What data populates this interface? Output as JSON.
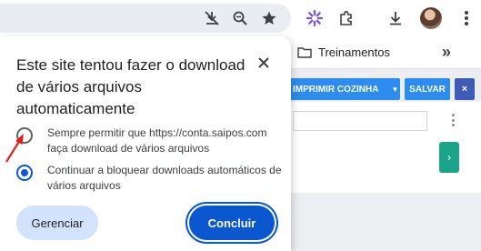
{
  "toolbar": {
    "icons": [
      "download-blocked-icon",
      "zoom-icon",
      "bookmark-star-icon",
      "extension-purple-icon",
      "extensions-puzzle-icon",
      "downloads-icon",
      "profile-avatar",
      "menu-icon"
    ]
  },
  "bookmarks": {
    "folder_label": "Treinamentos",
    "more_label": "»"
  },
  "page": {
    "imprimir_label": "IMPRIMIR COZINHA",
    "salvar_label": "SALVAR",
    "close_label": "×",
    "next_label": "›"
  },
  "dialog": {
    "title": "Este site tentou fazer o download de vários arquivos automaticamente",
    "options": [
      {
        "label": "Sempre permitir que https://conta.saipos.com faça download de vários arquivos",
        "selected": false
      },
      {
        "label": "Continuar a bloquear downloads automáticos de vários arquivos",
        "selected": true
      }
    ],
    "manage_label": "Gerenciar",
    "done_label": "Concluir"
  },
  "colors": {
    "accent": "#0b57d0",
    "page_button": "#2d8cf0",
    "green_button": "#1aa58a",
    "annotation_arrow": "#e0201c"
  }
}
